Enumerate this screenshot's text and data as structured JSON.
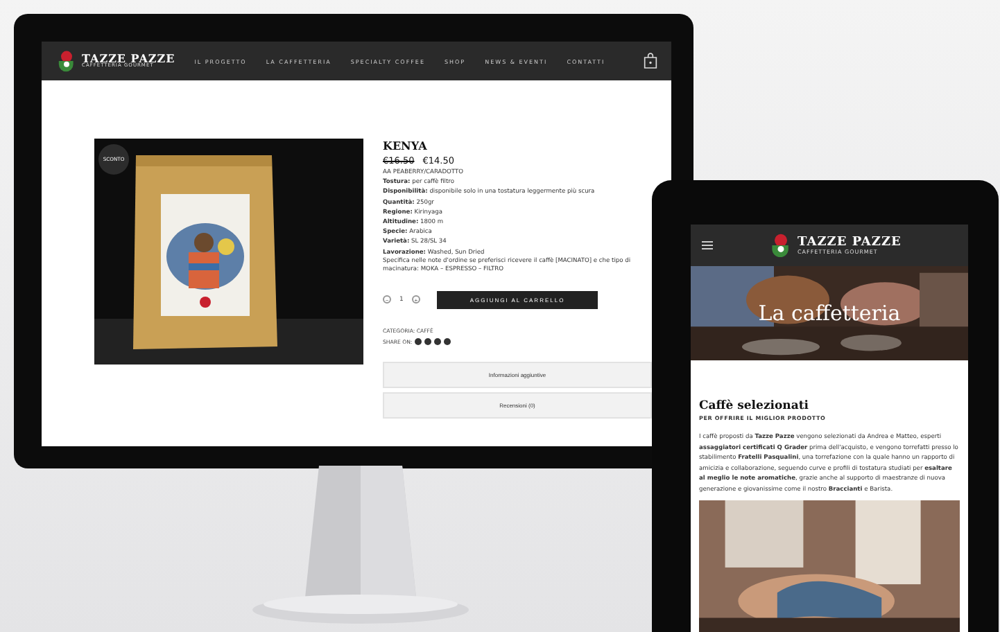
{
  "monitor": {
    "nav": {
      "logo_title": "TAZZE PAZZE",
      "logo_subtitle": "CAFFETTERIA GOURMET",
      "items": [
        "IL PROGETTO",
        "LA CAFFETTERIA",
        "SPECIALTY COFFEE",
        "SHOP",
        "NEWS & EVENTI",
        "CONTATTI"
      ]
    },
    "product": {
      "badge": "SCONTO",
      "name": "KENYA",
      "old_price": "€16.50",
      "price": "€14.50",
      "variant": "AA PEABERRY/CARADOTTO",
      "details": [
        {
          "label": "Tostura:",
          "value": "per caffè filtro"
        },
        {
          "label": "Disponibilità:",
          "value": "disponibile solo in una tostatura leggermente più scura"
        },
        {
          "label": "Quantità:",
          "value": "250gr"
        },
        {
          "label": "Regione:",
          "value": "Kirinyaga"
        },
        {
          "label": "Altitudine:",
          "value": "1800 m"
        },
        {
          "label": "Specie:",
          "value": "Arabica"
        },
        {
          "label": "Varietà:",
          "value": "SL 28/SL 34"
        },
        {
          "label": "Lavorazione:",
          "value": "Washed, Sun Dried"
        }
      ],
      "note": "Specifica nelle note d'ordine se preferisci ricevere il caffè [MACINATO] e che tipo di macinatura: MOKA – ESPRESSO – FILTRO",
      "quantity": {
        "minus": "−",
        "value": "1",
        "plus": "+"
      },
      "add_button": "AGGIUNGI AL CARRELLO",
      "category": "CATEGORIA: CAFFÈ",
      "share_label": "SHARE ON:",
      "tabs": [
        "Informazioni aggiuntive",
        "Recensioni (0)"
      ]
    }
  },
  "tablet": {
    "logo_title": "TAZZE PAZZE",
    "logo_subtitle": "CAFFETTERIA GOURMET",
    "hero_title": "La caffetteria",
    "heading": "Caffè selezionati",
    "subheading": "PER OFFRIRE IL MIGLIOR PRODOTTO",
    "paragraph": "I caffè proposti da **Tazze Pazze** vengono selezionati da Andrea e Matteo, esperti **assaggiatori certificati Q Grader** prima dell'acquisto, e vengono torrefatti presso lo stabilimento **Fratelli Pasqualini**, una torrefazione con la quale hanno un rapporto di amicizia e collaborazione, seguendo curve e profili di tostatura studiati per **esaltare al meglio le note aromatiche**, grazie anche al supporto di maestranze di nuova generazione e giovanissime come il nostro **Braccianti** e Barista."
  }
}
